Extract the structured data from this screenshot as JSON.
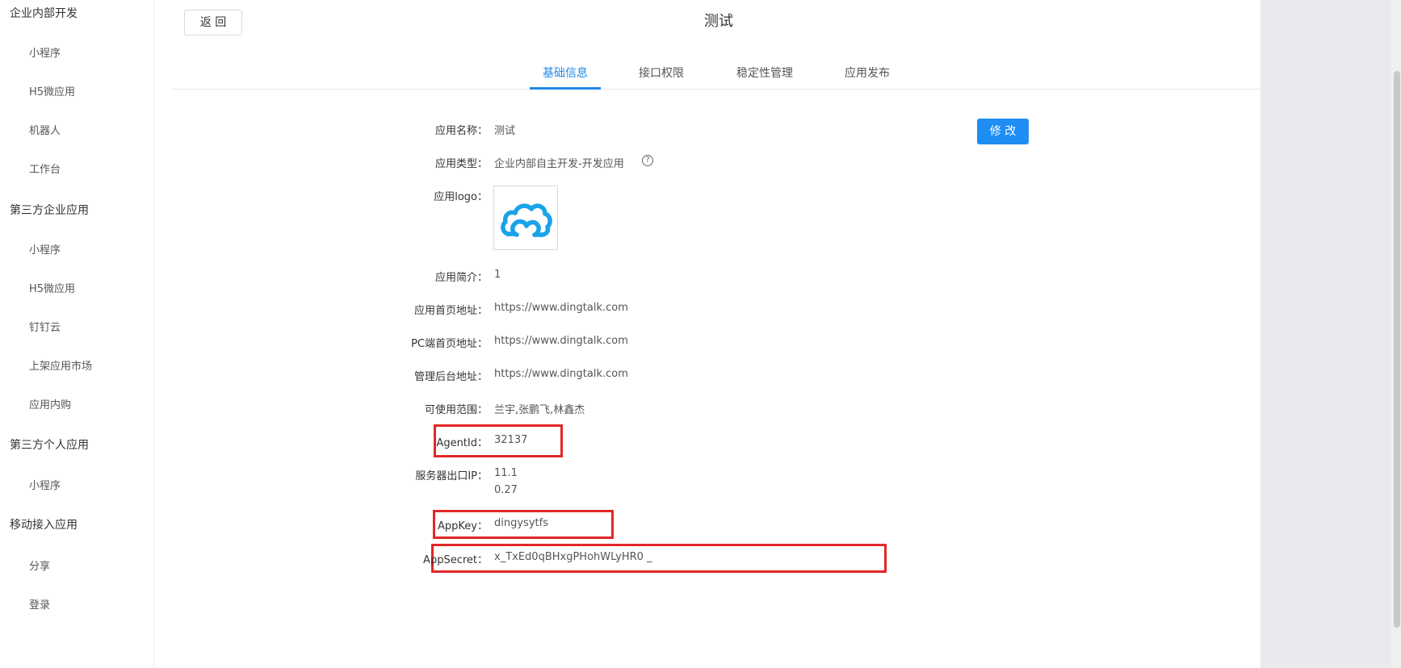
{
  "sidebar": {
    "groups": [
      {
        "title": "企业内部开发",
        "items": [
          "小程序",
          "H5微应用",
          "机器人",
          "工作台"
        ]
      },
      {
        "title": "第三方企业应用",
        "items": [
          "小程序",
          "H5微应用",
          "钉钉云",
          "上架应用市场",
          "应用内购"
        ]
      },
      {
        "title": "第三方个人应用",
        "items": [
          "小程序"
        ]
      },
      {
        "title": "移动接入应用",
        "items": [
          "分享",
          "登录"
        ]
      }
    ]
  },
  "header": {
    "back_label": "返 回",
    "title": "测试"
  },
  "tabs": [
    {
      "label": "基础信息",
      "active": true
    },
    {
      "label": "接口权限",
      "active": false
    },
    {
      "label": "稳定性管理",
      "active": false
    },
    {
      "label": "应用发布",
      "active": false
    }
  ],
  "edit_label": "修 改",
  "info": {
    "name": {
      "label": "应用名称：",
      "value": "测试"
    },
    "type": {
      "label": "应用类型：",
      "value": "企业内部自主开发-开发应用"
    },
    "logo": {
      "label": "应用logo："
    },
    "intro": {
      "label": "应用简介：",
      "value": "1"
    },
    "home_url": {
      "label": "应用首页地址：",
      "value": "https://www.dingtalk.com"
    },
    "pc_url": {
      "label": "PC端首页地址：",
      "value": "https://www.dingtalk.com"
    },
    "admin_url": {
      "label": "管理后台地址：",
      "value": "https://www.dingtalk.com"
    },
    "scope": {
      "label": "可使用范围：",
      "value": "兰宇,张鹏飞,林鑫杰"
    },
    "agent_id": {
      "label": "AgentId：",
      "value": "32137"
    },
    "server_ip": {
      "label": "服务器出口IP：",
      "value_line1": "11.1",
      "value_line2": "0.27"
    },
    "app_key": {
      "label": "AppKey：",
      "value": "dingysytfs"
    },
    "app_secret": {
      "label": "AppSecret：",
      "value": "x_TxEd0qBHxgPHohWLyHR0 _"
    }
  },
  "colors": {
    "accent": "#1e88e5",
    "button": "#1e8ef5",
    "highlight": "#e32727",
    "logo": "#1aa3e8"
  },
  "icons": {
    "help": "question-circle-icon",
    "logo": "dingtalk-cloud-logo"
  }
}
